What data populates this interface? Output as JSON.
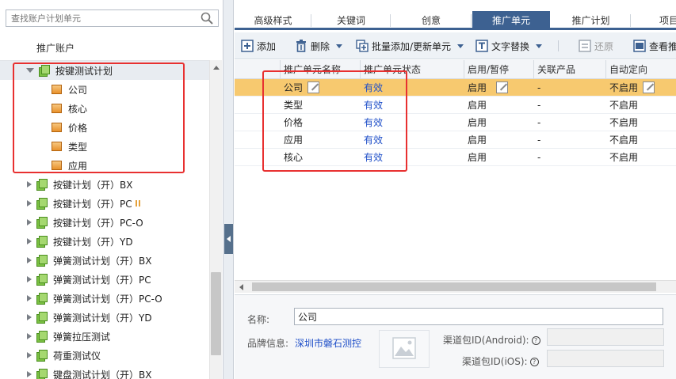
{
  "left": {
    "search_placeholder": "查找账户计划单元",
    "account_label": "推广账户",
    "tree": [
      {
        "label": "按键测试计划",
        "level": 0,
        "expanded": true,
        "type": "plan"
      },
      {
        "label": "公司",
        "level": 1,
        "type": "unit"
      },
      {
        "label": "核心",
        "level": 1,
        "type": "unit"
      },
      {
        "label": "价格",
        "level": 1,
        "type": "unit"
      },
      {
        "label": "类型",
        "level": 1,
        "type": "unit"
      },
      {
        "label": "应用",
        "level": 1,
        "type": "unit"
      },
      {
        "label": "按键计划（开）BX",
        "level": 0,
        "expanded": false,
        "type": "plan"
      },
      {
        "label": "按键计划（开）PC",
        "level": 0,
        "expanded": false,
        "type": "plan",
        "paused": true
      },
      {
        "label": "按键计划（开）PC-O",
        "level": 0,
        "expanded": false,
        "type": "plan"
      },
      {
        "label": "按键计划（开）YD",
        "level": 0,
        "expanded": false,
        "type": "plan"
      },
      {
        "label": "弹簧测试计划（开）BX",
        "level": 0,
        "expanded": false,
        "type": "plan"
      },
      {
        "label": "弹簧测试计划（开）PC",
        "level": 0,
        "expanded": false,
        "type": "plan"
      },
      {
        "label": "弹簧测试计划（开）PC-O",
        "level": 0,
        "expanded": false,
        "type": "plan"
      },
      {
        "label": "弹簧测试计划（开）YD",
        "level": 0,
        "expanded": false,
        "type": "plan"
      },
      {
        "label": "弹簧拉压测试",
        "level": 0,
        "expanded": false,
        "type": "plan"
      },
      {
        "label": "荷重测试仪",
        "level": 0,
        "expanded": false,
        "type": "plan"
      },
      {
        "label": "键盘测试计划（开）BX",
        "level": 0,
        "expanded": false,
        "type": "plan"
      }
    ]
  },
  "tabs": [
    "高级样式",
    "关键词",
    "创意",
    "推广单元",
    "推广计划",
    "项目"
  ],
  "active_tab": "推广单元",
  "toolbar": {
    "add": "添加",
    "delete": "删除",
    "batch": "批量添加/更新单元",
    "replace": "文字替换",
    "restore": "还原",
    "view": "查看推"
  },
  "grid": {
    "headers": [
      "推广单元名称",
      "推广单元状态",
      "启用/暂停",
      "关联产品",
      "自动定向"
    ],
    "rows": [
      {
        "name": "公司",
        "status": "有效",
        "enabled": "启用",
        "product": "-",
        "auto": "不启用"
      },
      {
        "name": "类型",
        "status": "有效",
        "enabled": "启用",
        "product": "-",
        "auto": "不启用"
      },
      {
        "name": "价格",
        "status": "有效",
        "enabled": "启用",
        "product": "-",
        "auto": "不启用"
      },
      {
        "name": "应用",
        "status": "有效",
        "enabled": "启用",
        "product": "-",
        "auto": "不启用"
      },
      {
        "name": "核心",
        "status": "有效",
        "enabled": "启用",
        "product": "-",
        "auto": "不启用"
      }
    ],
    "selected_row": 0
  },
  "detail": {
    "name_label": "名称:",
    "name_value": "公司",
    "brand_label": "品牌信息:",
    "brand_link": "深圳市磐石测控",
    "android_label": "渠道包ID(Android):",
    "ios_label": "渠道包ID(iOS):",
    "help_glyph": "?"
  },
  "colors": {
    "accent": "#3d6191",
    "selected_row": "#f7c96f",
    "status_link": "#1f4fc8",
    "annotation_red": "#e83030"
  }
}
